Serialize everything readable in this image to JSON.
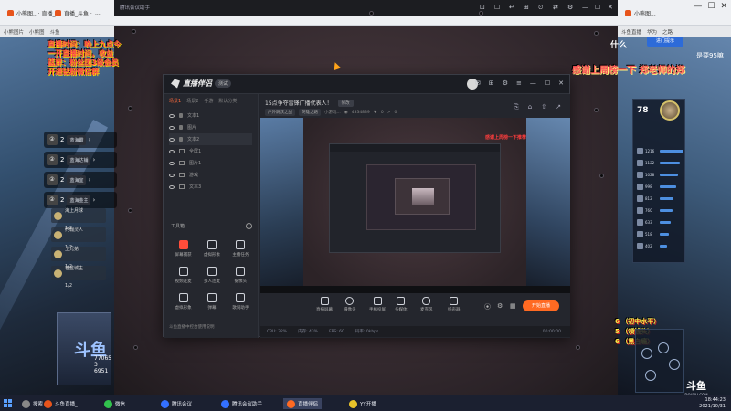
{
  "browser": {
    "tabs": [
      "小熊图.. · 直播_",
      "直播_斗鱼 ·",
      "...",
      "小熊图..."
    ],
    "bookmarks_left": [
      "小熊图片",
      "小熊图",
      "斗鱼"
    ],
    "bookmarks_right": [
      "斗鱼直播",
      "华为",
      "之路"
    ]
  },
  "mid_window": {
    "title": "腾讯会议助手",
    "controls": [
      "⊡",
      "☐",
      "↩",
      "⊞",
      "⏲",
      "⇄",
      "⚙",
      "—",
      "☐",
      "✕"
    ]
  },
  "left_overlay": {
    "lines": [
      "直播时间：晚上九点今",
      "一开直播时间，收益",
      "蓝屏：粉丝团3级会员",
      "开通钻粉微信群"
    ],
    "ranks": [
      {
        "badge": "②",
        "num": "2",
        "tag": "蓝海霸"
      },
      {
        "badge": "②",
        "num": "2",
        "tag": "蓝海达铺"
      },
      {
        "badge": "②",
        "num": "2",
        "tag": "蓝海宜"
      },
      {
        "badge": "②",
        "num": "2",
        "tag": "蓝海金主"
      }
    ],
    "mini": [
      {
        "title": "海上月球",
        "sub": "1/2"
      },
      {
        "title": "约翰灵人",
        "sub": "1/2"
      },
      {
        "title": "上兄弟",
        "sub": "1/2"
      },
      {
        "title": "苍蓝城主",
        "sub": "1/2"
      }
    ],
    "logo_text": "斗鱼",
    "logo_nums": [
      "77065",
      "3",
      "6951"
    ]
  },
  "app": {
    "name": "直播伴侣",
    "badge": "测试",
    "left_tabs": [
      "场景1",
      "场景2",
      "手游",
      "默认分类"
    ],
    "sources": [
      "文本1",
      "图片",
      "文本2",
      "全屏1",
      "图片1",
      "游戏",
      "文本3"
    ],
    "tools_label": "工具箱",
    "tools": [
      {
        "label": "屏幕捕获",
        "red": true
      },
      {
        "label": "虚拟形象",
        "red": false
      },
      {
        "label": "主播任务",
        "red": false
      },
      {
        "label": "视频连麦",
        "red": false
      },
      {
        "label": "多人连麦",
        "red": false
      },
      {
        "label": "摄像头",
        "red": false
      },
      {
        "label": "虚拟形象",
        "red": false
      },
      {
        "label": "弹幕",
        "red": false
      },
      {
        "label": "歌词助手",
        "red": false
      }
    ],
    "left_foot": "斗鱼直播中控台使用说明",
    "room": {
      "title": "15点争夺雷锋广播代表人！",
      "mod": "修改",
      "sub": [
        "户外跳跃之战",
        "英雄之路"
      ],
      "id": "小游戏...",
      "viewers": "4334839",
      "likes": "0",
      "shares": "0"
    },
    "main_ctrls": [
      "⎘",
      "⌂",
      "⇧",
      "↗"
    ],
    "preview_red": "感谢上周榜一下推荐",
    "bottom": [
      {
        "label": "直播屏幕"
      },
      {
        "label": "摄像头"
      },
      {
        "label": "手机投屏"
      },
      {
        "label": "多媒体"
      },
      {
        "label": "麦克风"
      },
      {
        "label": "扬声器"
      }
    ],
    "start_label": "开始直播",
    "status": [
      "CPU: 32%",
      "内存: 43%",
      "FPS: 60",
      "码率: 0kbps",
      "00:00:00"
    ]
  },
  "right_overlay": {
    "thanks": "感谢上周榜一下 郑老师的郑",
    "top": "什么",
    "top2": "是要95嘛",
    "share": "进门提示",
    "score": "78",
    "rows": [
      {
        "n": "1216",
        "w": 26
      },
      {
        "n": "1122",
        "w": 22
      },
      {
        "n": "1028",
        "w": 20
      },
      {
        "n": "998",
        "w": 18
      },
      {
        "n": "812",
        "w": 15
      },
      {
        "n": "760",
        "w": 14
      },
      {
        "n": "633",
        "w": 12
      },
      {
        "n": "518",
        "w": 10
      },
      {
        "n": "402",
        "w": 8
      }
    ],
    "lines": [
      "6 （初中水平）",
      "5 （领钱头）",
      "6 （黑白瘾）"
    ],
    "douyu": "斗鱼",
    "douyu_sub": "DOUYU.COM"
  },
  "taskbar": {
    "items": [
      {
        "label": "搜索",
        "color": "#888888"
      },
      {
        "label": "斗鱼直播_",
        "color": "#e7541b"
      },
      {
        "label": "微信",
        "color": "#31c24d"
      },
      {
        "label": "腾讯会议",
        "color": "#3370ff"
      },
      {
        "label": "腾讯会议助手",
        "color": "#3370ff"
      },
      {
        "label": "直播伴侣",
        "color": "#ff6a22"
      },
      {
        "label": "YY开播",
        "color": "#e8c32a"
      }
    ],
    "time": "18:44:23",
    "date": "2021/10/31"
  }
}
